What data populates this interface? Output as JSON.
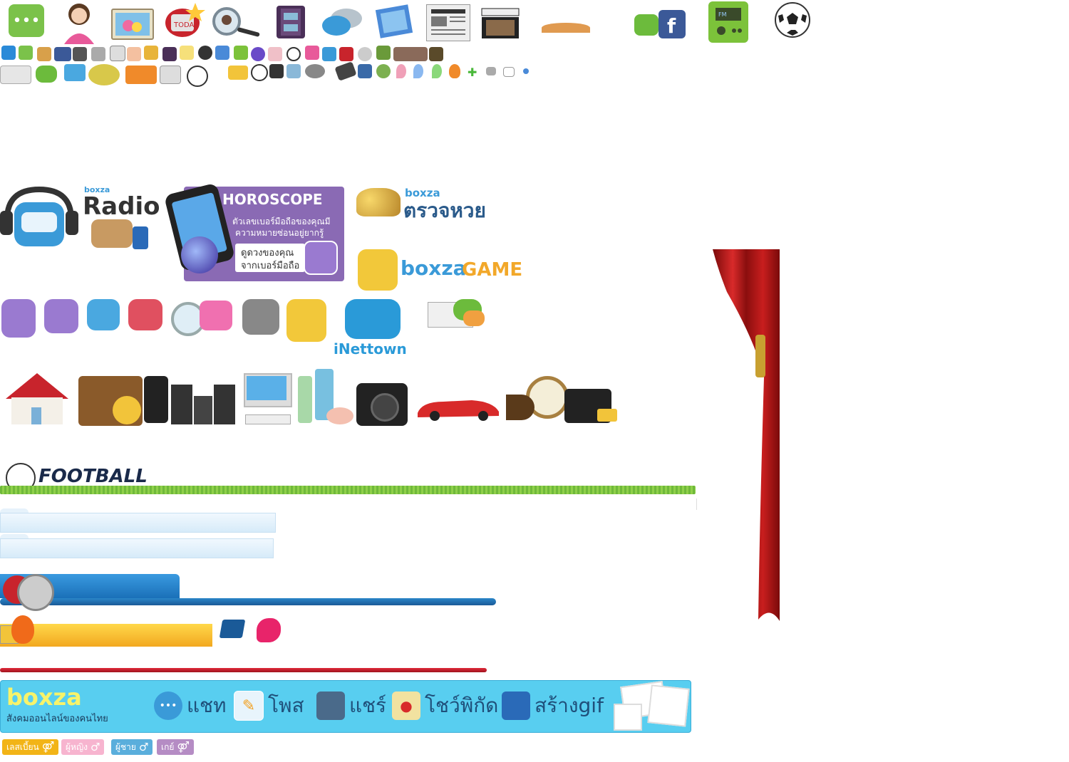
{
  "radio": {
    "brand": "boxza",
    "title": "Radio"
  },
  "horoscope": {
    "title": "HOROSCOPE",
    "line1": "ตัวเลขเบอร์มือถือของคุณมี",
    "line2": "ความหมายซ่อนอยู่ยากรู้",
    "line3": "ดูดวงของคุณ",
    "line4": "จากเบอร์มือถือ"
  },
  "lottery": {
    "brand": "boxza",
    "title": "ตรวจหวย"
  },
  "game": {
    "brand": "boxza",
    "title": "GAME"
  },
  "inettown": {
    "label": "iNettown"
  },
  "football": {
    "title": "FOOTBALL"
  },
  "footer": {
    "logo": "boxza",
    "tagline": "สังคมออนไลน์ของคนไทย",
    "nav": [
      {
        "label": "แชท",
        "icon": "chat-bubble-icon"
      },
      {
        "label": "โพส",
        "icon": "pencil-post-icon"
      },
      {
        "label": "แชร์",
        "icon": "share-photos-icon"
      },
      {
        "label": "โชว์พิกัด",
        "icon": "map-pin-icon"
      },
      {
        "label": "สร้างgif",
        "icon": "gif-image-icon"
      }
    ]
  },
  "filters": [
    {
      "label": "เลสเบี้ยน",
      "symbol": "⚤",
      "color": "#f2b417"
    },
    {
      "label": "ผู้หญิง",
      "symbol": "♂",
      "color": "#f7b4cf"
    },
    {
      "label": "ผู้ชาย",
      "symbol": "♂",
      "color": "#5aaedc"
    },
    {
      "label": "เกย์",
      "symbol": "⚤",
      "color": "#b58cc4"
    }
  ],
  "colors": {
    "bar_blue": "#2a86c8",
    "bar_orange": "#f7b417",
    "bar_red": "#c8242c",
    "footer_bg": "#58cef0",
    "curtain": "#b51a1a",
    "grass": "#6fb93a"
  }
}
